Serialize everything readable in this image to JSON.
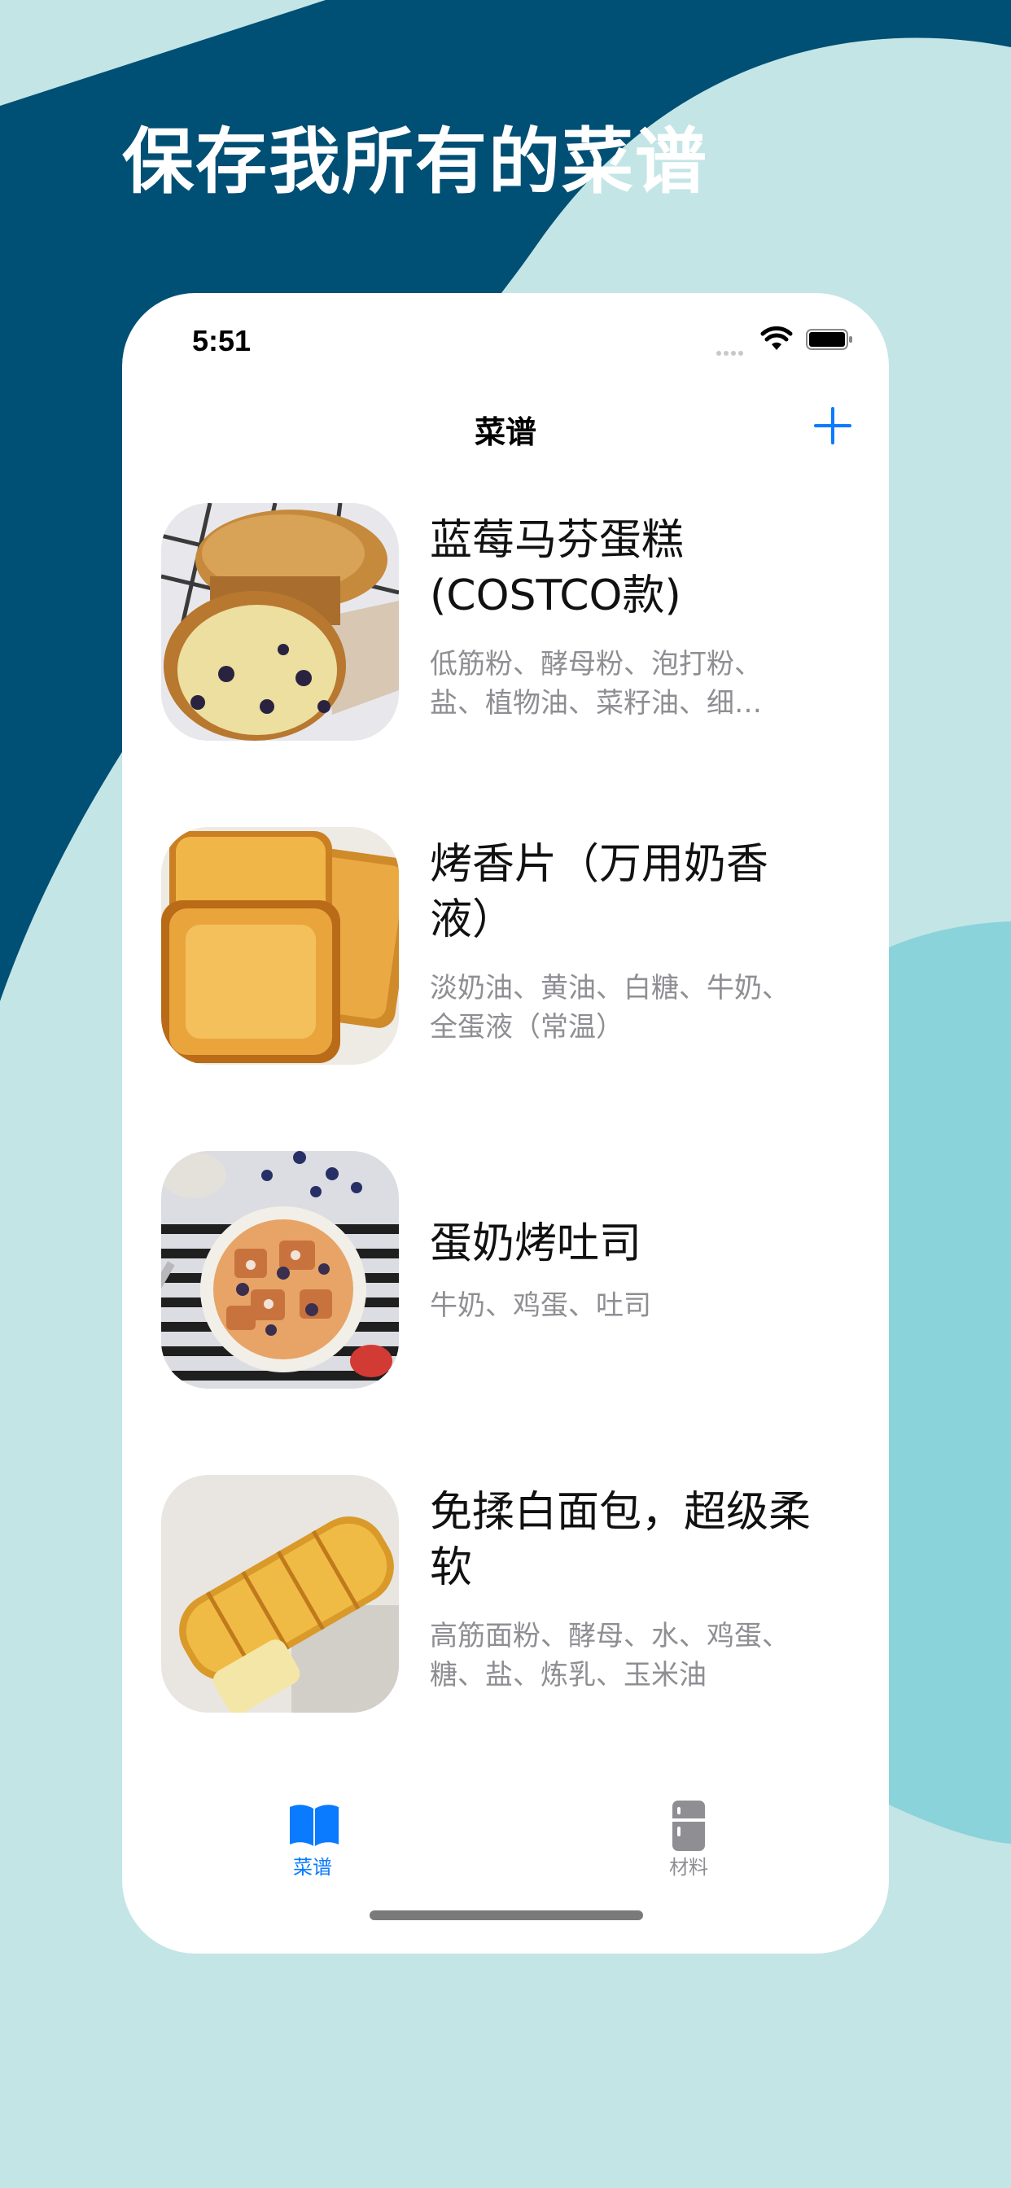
{
  "headline": "保存我所有的菜谱",
  "status_bar": {
    "time": "5:51"
  },
  "nav": {
    "title": "菜谱",
    "add_icon": "plus-icon"
  },
  "recipes": [
    {
      "title": "蓝莓马芬蛋糕(COSTCO款)",
      "ingredients": "低筋粉、酵母粉、泡打粉、盐、植物油、菜籽油、细…"
    },
    {
      "title": "烤香片（万用奶香液）",
      "ingredients": "淡奶油、黄油、白糖、牛奶、全蛋液（常温）"
    },
    {
      "title": "蛋奶烤吐司",
      "ingredients": "牛奶、鸡蛋、吐司"
    },
    {
      "title": "免揉白面包，超级柔软",
      "ingredients": "高筋面粉、酵母、水、鸡蛋、糖、盐、炼乳、玉米油"
    }
  ],
  "tabbar": {
    "tabs": [
      {
        "label": "菜谱",
        "icon": "book-icon",
        "selected": true
      },
      {
        "label": "材料",
        "icon": "fridge-icon",
        "selected": false
      }
    ]
  },
  "colors": {
    "background": "#c3e5e5",
    "navy": "#004f75",
    "accent_teal": "#8ad3da",
    "tint": "#0a7aff",
    "tab_inactive": "#8e8e93"
  }
}
